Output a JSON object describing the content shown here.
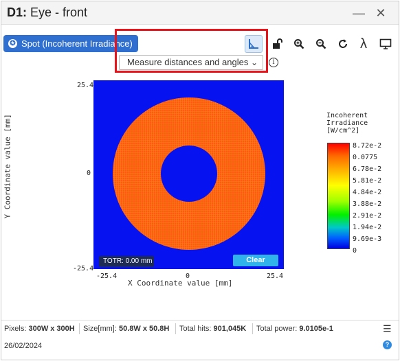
{
  "window": {
    "title_prefix": "D1:",
    "title_rest": " Eye - front",
    "minimize_glyph": "—",
    "close_glyph": "✕"
  },
  "toolbar": {
    "spot_label": "Spot (Incoherent Irradiance)",
    "measure_dropdown_value": "Measure distances and angles",
    "icons": [
      "ruler-angle-icon",
      "unlock-icon",
      "zoom-in-icon",
      "zoom-out-icon",
      "redo-icon",
      "lambda-icon",
      "monitor-icon"
    ],
    "lambda_glyph": "λ"
  },
  "plot": {
    "y_top": "25.4",
    "y_mid": "0",
    "y_bottom": "-25.4",
    "x_left": "-25.4",
    "x_mid": "0",
    "x_right": "25.4",
    "xlabel": "X Coordinate value [mm]",
    "ylabel": "Y Coordinate value [mm]",
    "totr_label": "TOTR: 0.00 mm",
    "clear_label": "Clear",
    "background_color": "#0612f0",
    "ring_color": "#ff5a10"
  },
  "legend": {
    "title": "Incoherent\nIrradiance\n[W/cm^2]",
    "ticks": [
      "8.72e-2",
      "0.0775",
      "6.78e-2",
      "5.81e-2",
      "4.84e-2",
      "3.88e-2",
      "2.91e-2",
      "1.94e-2",
      "9.69e-3",
      "0"
    ]
  },
  "status": {
    "pixels_label": "Pixels:",
    "pixels_value": "300W x 300H",
    "size_label": "Size[mm]:",
    "size_value": "50.8W x 50.8H",
    "hits_label": "Total hits:",
    "hits_value": "901,045K",
    "power_label": "Total power:",
    "power_value": "9.0105e-1",
    "date": "26/02/2024"
  }
}
